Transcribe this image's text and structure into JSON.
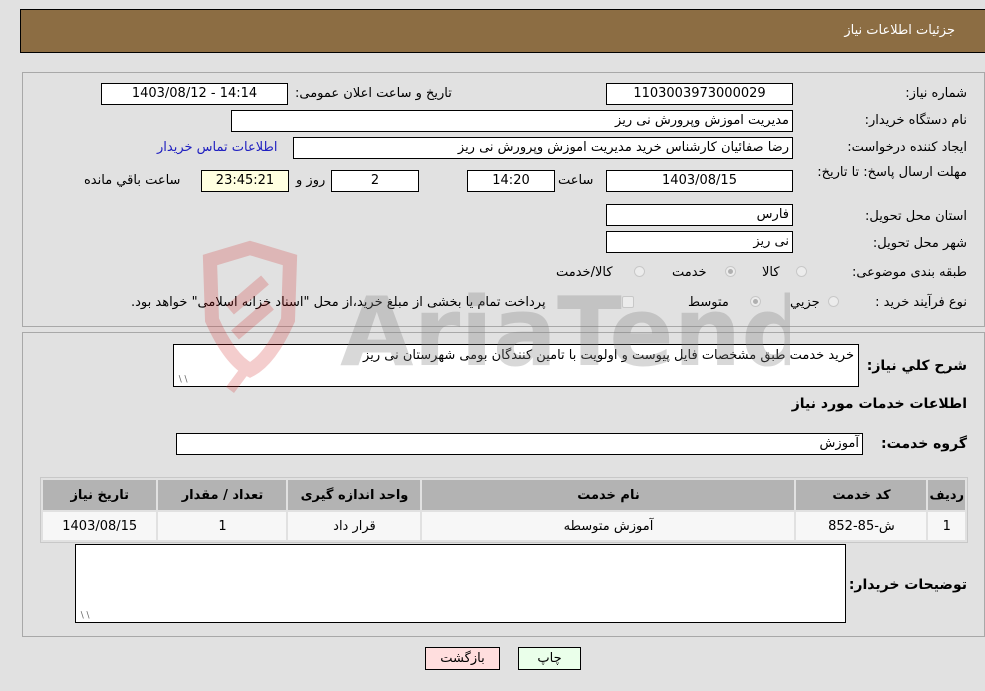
{
  "header": {
    "title": "جزئیات اطلاعات نیاز"
  },
  "fields": {
    "need_number": {
      "label": "شماره نیاز:",
      "value": "1103003973000029"
    },
    "announce_datetime": {
      "label": "تاریخ و ساعت اعلان عمومی:",
      "value": "1403/08/12 - 14:14"
    },
    "buyer_org": {
      "label": "نام دستگاه خریدار:",
      "value": "مدیریت اموزش وپرورش نی ریز"
    },
    "requester": {
      "label": "ایجاد کننده درخواست:",
      "value": "رضا صفائیان کارشناس خرید مدیریت اموزش وپرورش نی ریز"
    },
    "buyer_contact_link": "اطلاعات تماس خریدار",
    "deadline": {
      "label": "مهلت ارسال پاسخ: تا تاریخ:",
      "date": "1403/08/15",
      "time_label": "ساعت",
      "time": "14:20",
      "days": "2",
      "days_label": "روز و",
      "remaining": "23:45:21",
      "remaining_label": "ساعت باقي مانده"
    },
    "province": {
      "label": "استان محل تحویل:",
      "value": "فارس"
    },
    "city": {
      "label": "شهر محل تحویل:",
      "value": "نی ریز"
    },
    "category": {
      "label": "طبقه بندی موضوعی:",
      "options": [
        "کالا",
        "خدمت",
        "کالا/خدمت"
      ],
      "selected": "خدمت"
    },
    "purchase_type": {
      "label": "نوع فرآیند خرید :",
      "options": [
        "جزيي",
        "متوسط"
      ],
      "selected": "متوسط",
      "treasury_note": "پرداخت تمام یا بخشی از مبلغ خرید،از محل \"اسناد خزانه اسلامی\" خواهد بود."
    }
  },
  "description": {
    "label": "شرح کلي نیاز:",
    "value": "خرید خدمت طبق مشخصات فایل پیوست و اولویت با تامین کنندگان بومی شهرستان نی ریز"
  },
  "services_section": {
    "title": "اطلاعات خدمات مورد نیاز",
    "group_label": "گروه خدمت:",
    "group_value": "آموزش",
    "table": {
      "headers": [
        "ردیف",
        "کد خدمت",
        "نام خدمت",
        "واحد اندازه گیری",
        "تعداد / مقدار",
        "تاریخ نیاز"
      ],
      "rows": [
        [
          "1",
          "ش-85-852",
          "آموزش متوسطه",
          "قرار داد",
          "1",
          "1403/08/15"
        ]
      ]
    }
  },
  "buyer_notes": {
    "label": "توضیحات خریدار:",
    "value": ""
  },
  "buttons": {
    "print": "چاپ",
    "back": "بازگشت"
  },
  "watermark": {
    "text": "AriaTender.neT"
  },
  "colors": {
    "header_bg": "#8c6d43",
    "print_bg": "#eaffea",
    "back_bg": "#ffdede",
    "remaining_bg": "#ffffe0",
    "link": "#2020c0"
  }
}
